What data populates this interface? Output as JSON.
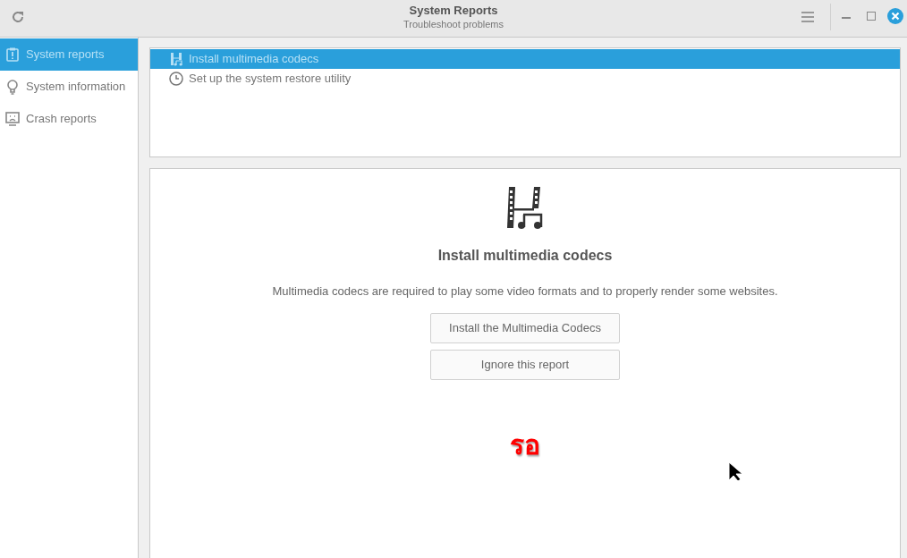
{
  "window": {
    "title": "System Reports",
    "subtitle": "Troubleshoot problems"
  },
  "sidebar": {
    "items": [
      {
        "label": "System reports",
        "kind": "clipboard",
        "selected": true
      },
      {
        "label": "System information",
        "kind": "bulb",
        "selected": false
      },
      {
        "label": "Crash reports",
        "kind": "monitor",
        "selected": false
      }
    ]
  },
  "reports": [
    {
      "label": "Install multimedia codecs",
      "kind": "codec",
      "selected": true
    },
    {
      "label": "Set up the system restore utility",
      "kind": "clock",
      "selected": false
    }
  ],
  "detail": {
    "title": "Install multimedia codecs",
    "description": "Multimedia codecs are required to play some video formats and to properly render some websites.",
    "buttons": [
      "Install the Multimedia Codecs",
      "Ignore this report"
    ]
  },
  "overlay_text": "รอ"
}
